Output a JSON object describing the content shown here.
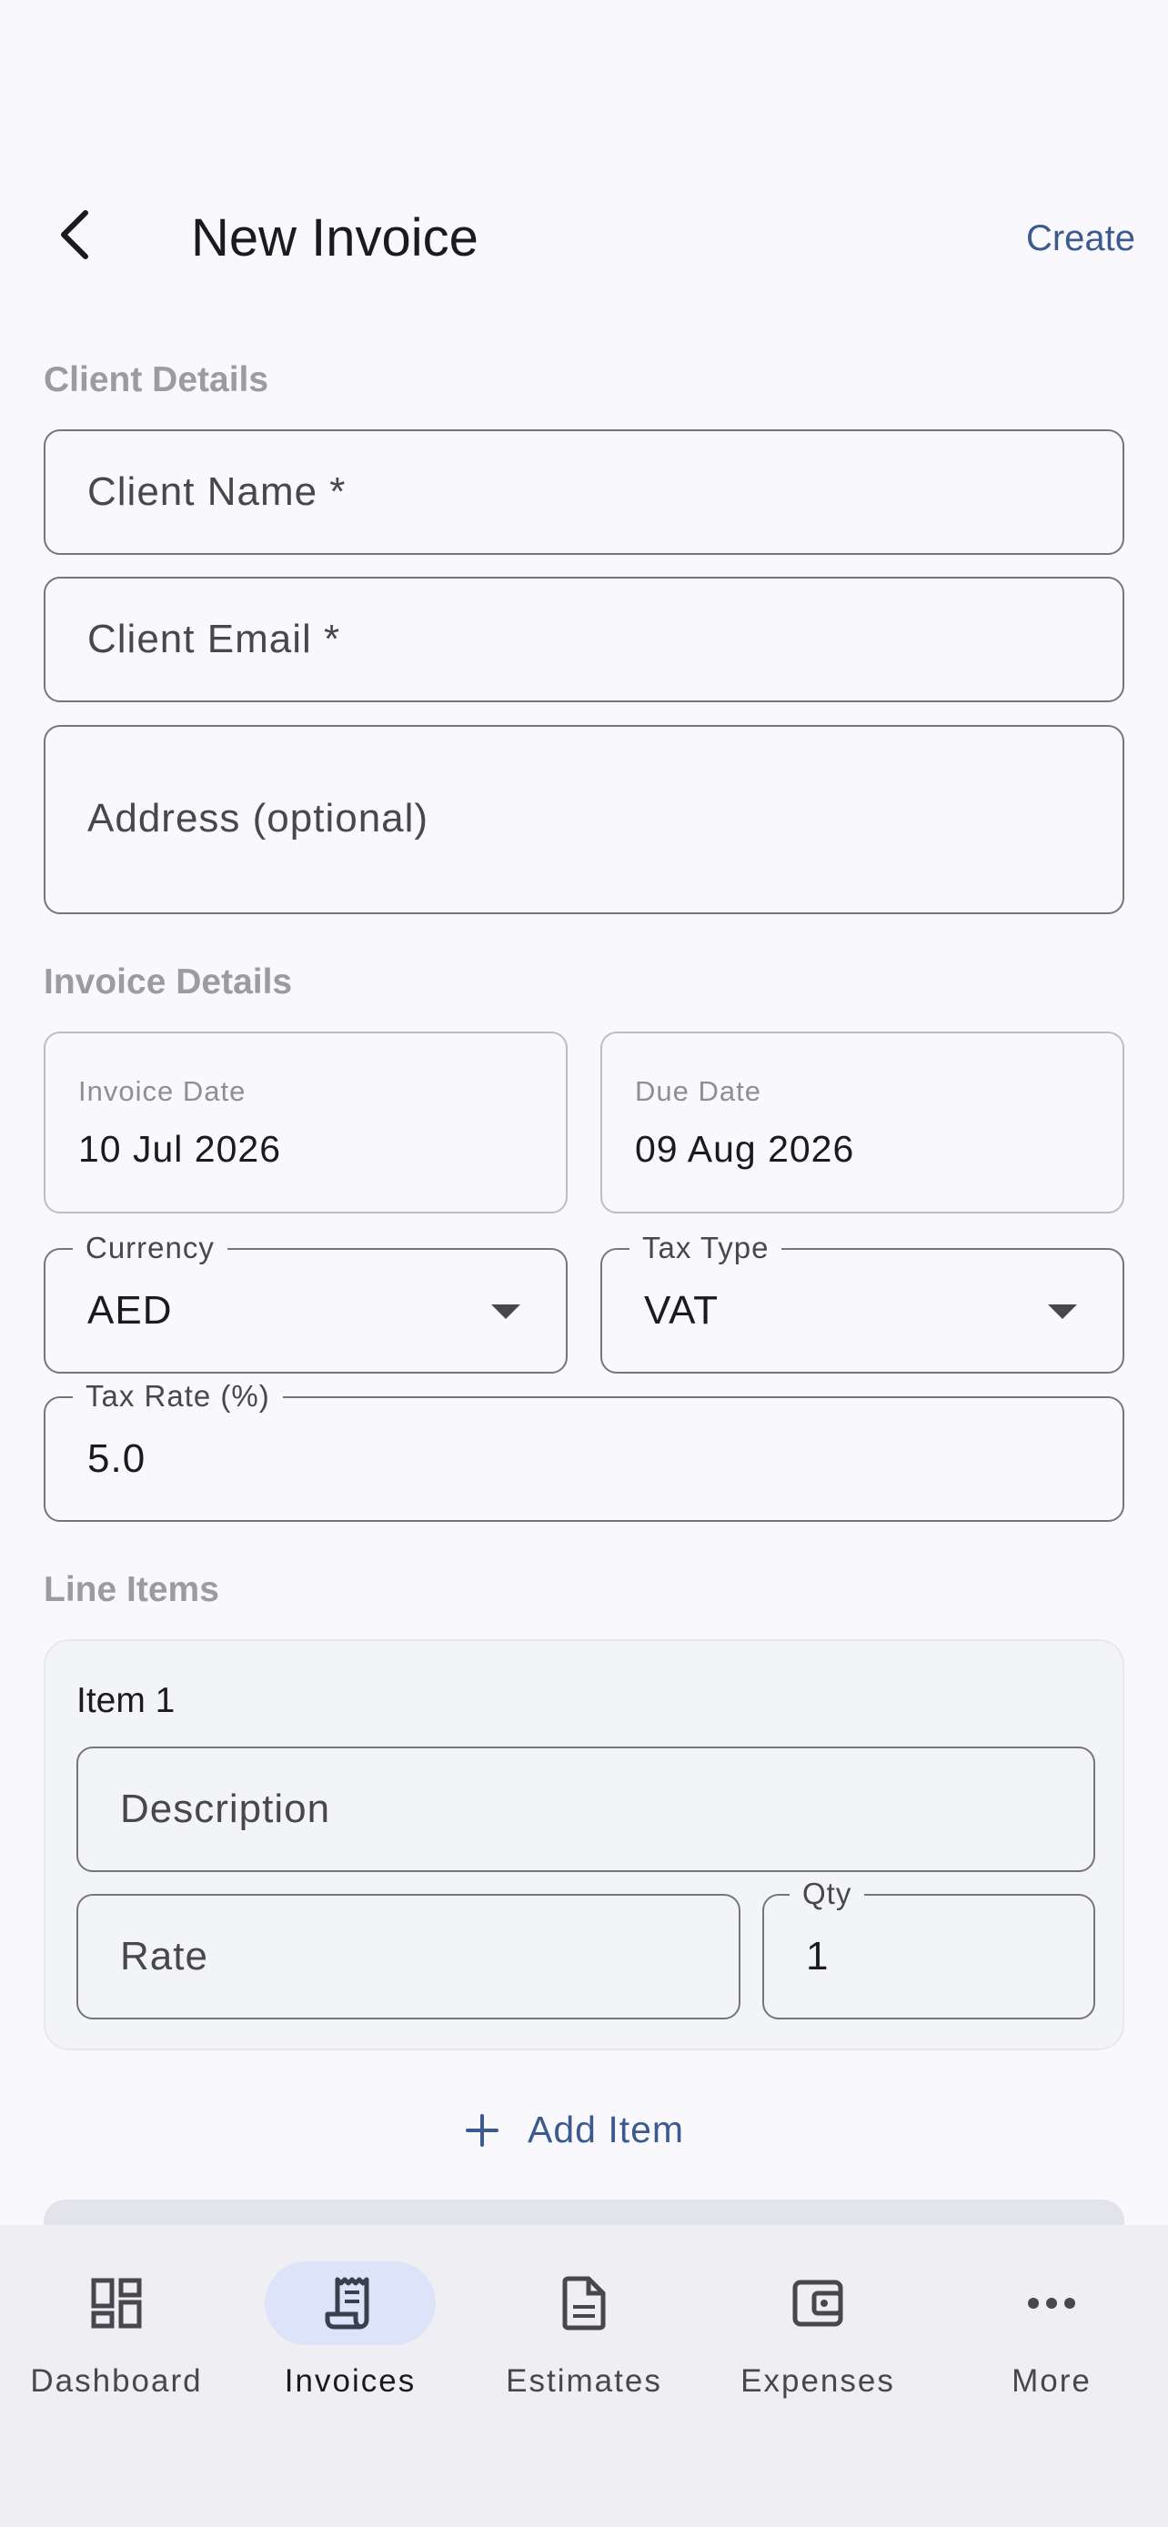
{
  "header": {
    "title": "New Invoice",
    "create_label": "Create"
  },
  "client": {
    "section_label": "Client Details",
    "name_placeholder": "Client Name *",
    "email_placeholder": "Client Email *",
    "address_placeholder": "Address (optional)"
  },
  "invoice": {
    "section_label": "Invoice Details",
    "invoice_date_label": "Invoice Date",
    "invoice_date_value": "10 Jul 2026",
    "due_date_label": "Due Date",
    "due_date_value": "09 Aug 2026",
    "currency_label": "Currency",
    "currency_value": "AED",
    "tax_type_label": "Tax Type",
    "tax_type_value": "VAT",
    "tax_rate_label": "Tax Rate (%)",
    "tax_rate_value": "5.0"
  },
  "line_items": {
    "section_label": "Line Items",
    "items": [
      {
        "title": "Item 1",
        "description_placeholder": "Description",
        "rate_placeholder": "Rate",
        "qty_label": "Qty",
        "qty_value": "1"
      }
    ],
    "add_item_label": "Add Item"
  },
  "nav": {
    "items": [
      {
        "label": "Dashboard",
        "icon": "dashboard-icon",
        "active": false
      },
      {
        "label": "Invoices",
        "icon": "receipt-icon",
        "active": true
      },
      {
        "label": "Estimates",
        "icon": "document-icon",
        "active": false
      },
      {
        "label": "Expenses",
        "icon": "wallet-icon",
        "active": false
      },
      {
        "label": "More",
        "icon": "more-horizontal-icon",
        "active": false
      }
    ]
  },
  "colors": {
    "accent": "#3d5a8e",
    "active_nav_bg": "#dde3f8",
    "background": "#f9f9fd"
  }
}
